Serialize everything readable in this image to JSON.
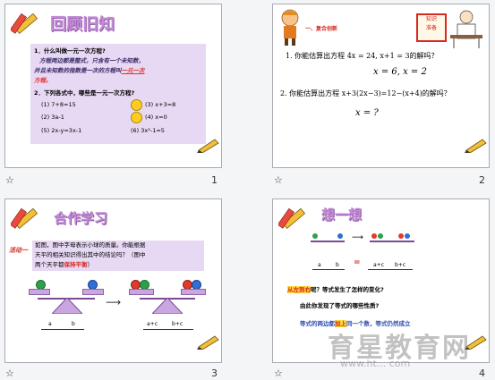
{
  "slides": [
    {
      "number": "1",
      "title": "回顾旧知",
      "q1": "1．什么叫做一元一次方程?",
      "q1_answer_a": "方程两边都是整式，只含有一个未知数，",
      "q1_answer_b": "并且未知数的指数是一次的方程叫",
      "q1_answer_highlight": "一元一次",
      "q1_answer_c": "方程。",
      "q2": "2．下列各式中，哪些是一元一次方程?",
      "items": [
        {
          "label": "(1)",
          "expr": "7+8=15"
        },
        {
          "label": "(2)",
          "expr": "3a-1"
        },
        {
          "label": "(3)",
          "expr": "x+3=8"
        },
        {
          "label": "(4)",
          "expr": "x=0"
        },
        {
          "label": "(5)",
          "expr": "2x-y=3x-1"
        },
        {
          "label": "(6)",
          "expr": "3x²-1=5"
        }
      ]
    },
    {
      "number": "2",
      "sign_text": "知识\n准备",
      "tag": "一、复合创新",
      "q1": "1. 你能估算出方程 4x = 24, x+1 = 3的解吗？",
      "q1_answer": "x = 6, x = 2",
      "q2": "2. 你能估算出方程 x+3(2x−3)=12−(x+4)的解吗？",
      "q2_answer": "x = ?"
    },
    {
      "number": "3",
      "title": "合作学习",
      "activity_label": "活动一",
      "text_a": "如图，图中字母表示小球的质量。你能根据",
      "text_b": "天平的相关知识得出其中的结论吗？（图中",
      "text_c": "两个天平都",
      "text_highlight": "保持平衡",
      "text_d": "）",
      "left_scale_labels": [
        "a",
        "b"
      ],
      "right_scale_labels": [
        "a+c",
        "b+c"
      ]
    },
    {
      "number": "4",
      "title": "想一想",
      "scale_labels_left": [
        "a",
        "b"
      ],
      "scale_labels_right": [
        "a+c",
        "b+c"
      ],
      "eq_sign": "=",
      "q_tag": "从左到右",
      "q_line1": "呢？等式发生了怎样的变化?",
      "q_line2": "由此你发现了等式的哪些性质?",
      "q_line3a": "等式的两边都",
      "q_line3_highlight": "加上",
      "q_line3b": "同一个数，等式仍然成立"
    }
  ],
  "watermark": "育星教育网",
  "watermark_sub": "www.ht... com"
}
